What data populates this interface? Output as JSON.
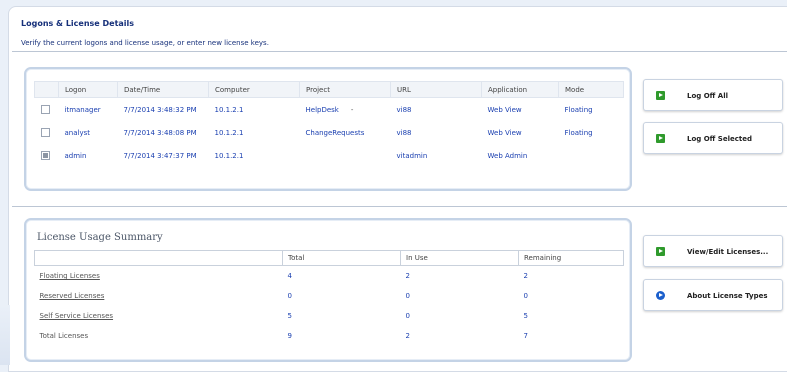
{
  "header": {
    "title": "Logons & License Details",
    "subtitle": "Verify the current logons and license usage, or enter new license keys."
  },
  "logons": {
    "columns": [
      "Logon",
      "Date/Time",
      "Computer",
      "Project",
      "URL",
      "Application",
      "Mode"
    ],
    "rows": [
      {
        "checked": false,
        "logon": "itmanager",
        "datetime": "7/7/2014 3:48:32 PM",
        "computer": "10.1.2.1",
        "project": "HelpDesk",
        "project_suffix": "-",
        "url": "vi88",
        "application": "Web View",
        "mode": "Floating"
      },
      {
        "checked": false,
        "logon": "analyst",
        "datetime": "7/7/2014 3:48:08 PM",
        "computer": "10.1.2.1",
        "project": "ChangeRequests",
        "project_suffix": "",
        "url": "vi88",
        "application": "Web View",
        "mode": "Floating"
      },
      {
        "checked": true,
        "logon": "admin",
        "datetime": "7/7/2014 3:47:37 PM",
        "computer": "10.1.2.1",
        "project": "",
        "project_suffix": "",
        "url": "vitadmin",
        "application": "Web Admin",
        "mode": ""
      }
    ]
  },
  "usage": {
    "title": "License Usage Summary",
    "columns": [
      "Total",
      "In Use",
      "Remaining"
    ],
    "rows": [
      {
        "label": "Floating Licenses",
        "total": "4",
        "in_use": "2",
        "remaining": "2"
      },
      {
        "label": "Reserved Licenses",
        "total": "0",
        "in_use": "0",
        "remaining": "0"
      },
      {
        "label": "Self Service Licenses",
        "total": "5",
        "in_use": "0",
        "remaining": "5"
      },
      {
        "label": "Total Licenses",
        "total": "9",
        "in_use": "2",
        "remaining": "7"
      }
    ]
  },
  "actions": {
    "log_off_all": "Log Off All",
    "log_off_selected": "Log Off Selected",
    "view_edit_licenses": "View/Edit Licenses...",
    "about_license_types": "About License Types"
  },
  "colors": {
    "title_blue": "#16307a",
    "link_blue": "#1a3fb0",
    "green_icon": "#2f9a2c",
    "blue_icon": "#1b5fcc",
    "panel_border": "#c4d3e6"
  },
  "icons": {
    "log_off_all": "green-arrow-icon",
    "log_off_selected": "green-arrow-icon",
    "view_edit_licenses": "green-arrow-icon",
    "about_license_types": "blue-circle-arrow-icon"
  }
}
